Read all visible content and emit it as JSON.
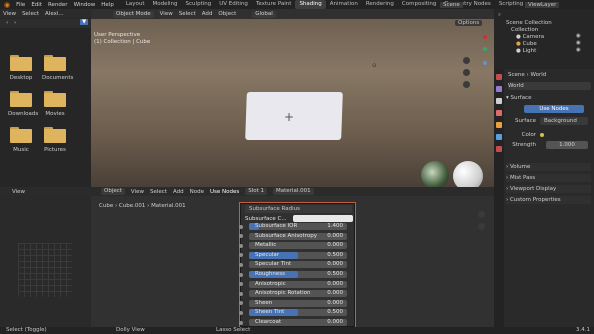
{
  "topbar": {
    "menus": [
      "File",
      "Edit",
      "Render",
      "Window",
      "Help"
    ],
    "workspaces": [
      "Layout",
      "Modeling",
      "Sculpting",
      "UV Editing",
      "Texture Paint",
      "Shading",
      "Animation",
      "Rendering",
      "Compositing",
      "Geometry Nodes",
      "Scripting"
    ],
    "active_workspace": "Shading",
    "scene": "Scene",
    "view_layer": "ViewLayer"
  },
  "file_browser": {
    "header": [
      "View",
      "Select"
    ],
    "path": "Alexi...",
    "folders": [
      "Desktop",
      "Documents",
      "Downloads",
      "Movies",
      "Music",
      "Pictures"
    ]
  },
  "viewport": {
    "header": [
      "Object Mode",
      "View",
      "Select",
      "Add",
      "Object"
    ],
    "orientation": "Global",
    "options": "Options",
    "overlay_title": "User Perspective",
    "overlay_sub": "(1) Collection | Cube"
  },
  "outliner": {
    "root": "Scene Collection",
    "collection": "Collection",
    "items": [
      "Camera",
      "Cube",
      "Light"
    ]
  },
  "properties": {
    "breadcrumb": [
      "Scene",
      "World"
    ],
    "world_name": "World",
    "section": "Surface",
    "use_nodes": "Use Nodes",
    "surface_label": "Surface",
    "surface_value": "Background",
    "color_label": "Color",
    "strength_label": "Strength",
    "strength_value": "1.000",
    "panels": [
      "Volume",
      "Mist Pass",
      "Viewport Display",
      "Custom Properties"
    ]
  },
  "node_editor": {
    "header": [
      "Object",
      "View",
      "Select",
      "Add",
      "Node",
      "Use Nodes",
      "Slot 1",
      "Material.001"
    ],
    "breadcrumb": [
      "Cube",
      "Cube.001",
      "Material.001"
    ],
    "node_top": "Subsurface Radius",
    "node_field": "Subsurface C...",
    "rows": [
      {
        "label": "Subsurface IOR",
        "value": "1.400",
        "fill": 0.1
      },
      {
        "label": "Subsurface Anisotropy",
        "value": "0.000",
        "fill": 0
      },
      {
        "label": "Metallic",
        "value": "0.000",
        "fill": 0
      },
      {
        "label": "Specular",
        "value": "0.500",
        "fill": 0.5
      },
      {
        "label": "Specular Tint",
        "value": "0.000",
        "fill": 0
      },
      {
        "label": "Roughness",
        "value": "0.500",
        "fill": 0.5
      },
      {
        "label": "Anisotropic",
        "value": "0.000",
        "fill": 0
      },
      {
        "label": "Anisotropic Rotation",
        "value": "0.000",
        "fill": 0
      },
      {
        "label": "Sheen",
        "value": "0.000",
        "fill": 0
      },
      {
        "label": "Sheen Tint",
        "value": "0.500",
        "fill": 0.5
      },
      {
        "label": "Clearcoat",
        "value": "0.000",
        "fill": 0
      }
    ]
  },
  "status": {
    "left": "Select (Toggle)",
    "middle": "Dolly View",
    "right": "Lasso Select",
    "version": "3.4.1"
  },
  "colors": {
    "accent": "#4772b3",
    "node_outline": "#c06040"
  }
}
